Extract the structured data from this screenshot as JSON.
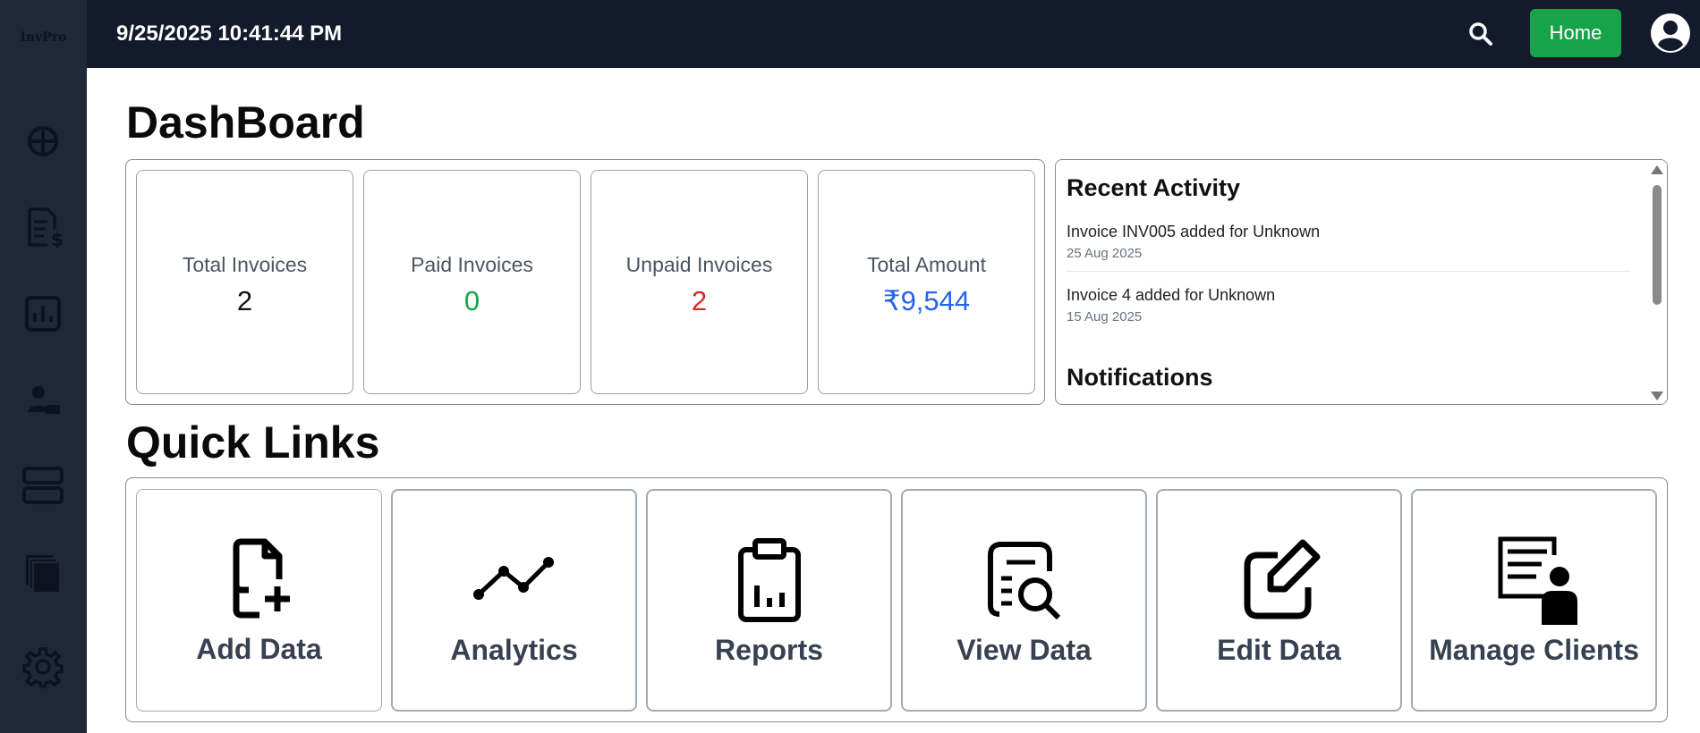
{
  "app": {
    "logo": "InvPro"
  },
  "topbar": {
    "datetime": "9/25/2025 10:41:44 PM",
    "home_label": "Home"
  },
  "colors": {
    "sidebar": "#1e2838",
    "topbar": "#121a2b",
    "home_button": "#16a34a",
    "paid": "#16a34a",
    "unpaid": "#dc2626",
    "amount": "#2563eb"
  },
  "sidebar": {
    "items": [
      {
        "icon": "dashboard-icon"
      },
      {
        "icon": "invoice-icon"
      },
      {
        "icon": "chart-icon"
      },
      {
        "icon": "client-icon"
      },
      {
        "icon": "layout-icon"
      },
      {
        "icon": "documents-icon"
      },
      {
        "icon": "gear-icon"
      }
    ]
  },
  "page": {
    "title": "DashBoard",
    "quick_links_title": "Quick Links"
  },
  "stats": [
    {
      "label": "Total Invoices",
      "value": "2"
    },
    {
      "label": "Paid Invoices",
      "value": "0"
    },
    {
      "label": "Unpaid Invoices",
      "value": "2"
    },
    {
      "label": "Total Amount",
      "value": "₹9,544"
    }
  ],
  "activity": {
    "heading": "Recent Activity",
    "items": [
      {
        "text": "Invoice INV005 added for Unknown",
        "date": "25 Aug 2025"
      },
      {
        "text": "Invoice 4 added for Unknown",
        "date": "15 Aug 2025"
      }
    ],
    "notifications_heading": "Notifications"
  },
  "quick_links": [
    {
      "label": "Add Data",
      "icon": "file-plus-icon"
    },
    {
      "label": "Analytics",
      "icon": "trend-line-icon"
    },
    {
      "label": "Reports",
      "icon": "clipboard-chart-icon"
    },
    {
      "label": "View Data",
      "icon": "document-search-icon"
    },
    {
      "label": "Edit Data",
      "icon": "edit-icon"
    },
    {
      "label": "Manage Clients",
      "icon": "client-list-icon"
    }
  ]
}
